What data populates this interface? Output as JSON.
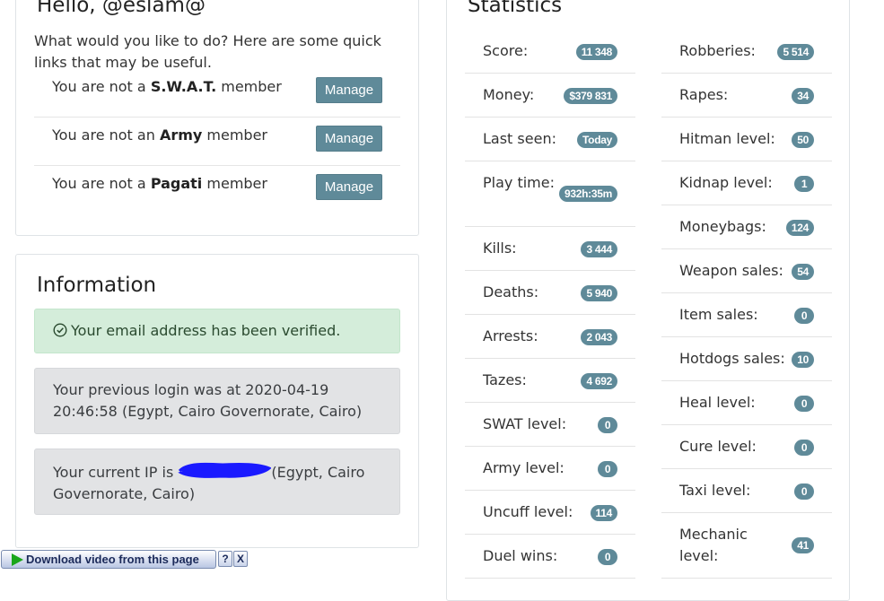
{
  "hello": {
    "title": "Hello, @eslam@",
    "intro": "What would you like to do? Here are some quick links that may be useful.",
    "links": [
      {
        "prefix": "You are not a ",
        "group": "S.W.A.T.",
        "suffix": " member",
        "button": "Manage"
      },
      {
        "prefix": "You are not an ",
        "group": "Army",
        "suffix": " member",
        "button": "Manage"
      },
      {
        "prefix": "You are not a ",
        "group": "Pagati",
        "suffix": " member",
        "button": "Manage"
      }
    ]
  },
  "info": {
    "title": "Information",
    "verified": "Your email address has been verified.",
    "previous_login": "Your previous login was at 2020-04-19 20:46:58 (Egypt, Cairo Governorate, Cairo)",
    "ip_prefix": "Your current IP is ",
    "ip_suffix": "(Egypt, Cairo Governorate, Cairo)",
    "colors": {
      "success_bg": "#d4edda",
      "grey_bg": "#e2e3e5"
    }
  },
  "stats": {
    "title": "Statistics",
    "badge_color": "#5f8a99",
    "left": [
      {
        "label": "Score:",
        "value": "11 348"
      },
      {
        "label": "Money:",
        "value": "$379 831"
      },
      {
        "label": "Last seen:",
        "value": "Today"
      },
      {
        "label": "Play time:",
        "value": "932h:35m"
      },
      {
        "label": "Kills:",
        "value": "3 444"
      },
      {
        "label": "Deaths:",
        "value": "5 940"
      },
      {
        "label": "Arrests:",
        "value": "2 043"
      },
      {
        "label": "Tazes:",
        "value": "4 692"
      },
      {
        "label": "SWAT level:",
        "value": "0"
      },
      {
        "label": "Army level:",
        "value": "0"
      },
      {
        "label": "Uncuff level:",
        "value": "114"
      },
      {
        "label": "Duel wins:",
        "value": "0"
      }
    ],
    "right": [
      {
        "label": "Robberies:",
        "value": "5 514"
      },
      {
        "label": "Rapes:",
        "value": "34"
      },
      {
        "label": "Hitman level:",
        "value": "50"
      },
      {
        "label": "Kidnap level:",
        "value": "1"
      },
      {
        "label": "Moneybags:",
        "value": "124"
      },
      {
        "label": "Weapon sales:",
        "value": "54"
      },
      {
        "label": "Item sales:",
        "value": "0"
      },
      {
        "label": "Hotdogs sales:",
        "value": "10"
      },
      {
        "label": "Heal level:",
        "value": "0"
      },
      {
        "label": "Cure level:",
        "value": "0"
      },
      {
        "label": "Taxi level:",
        "value": "0"
      },
      {
        "label": "Mechanic level:",
        "value": "41"
      }
    ]
  },
  "download_bar": {
    "label": "Download video from this page",
    "help": "?",
    "close": "X",
    "play_icon": "play-icon"
  }
}
